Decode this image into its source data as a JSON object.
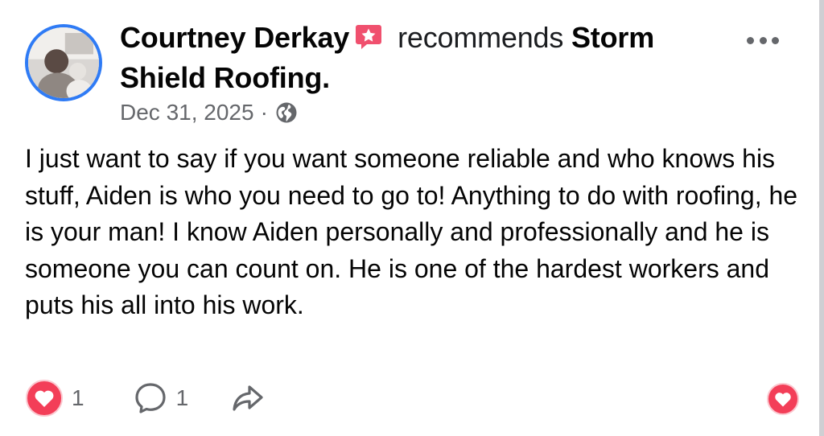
{
  "post": {
    "author": "Courtney Derkay",
    "verb": "recommends",
    "page_name": "Storm Shield Roofing.",
    "date": "Dec 31, 2025",
    "separator": "·",
    "audience_icon": "globe-icon",
    "body": "I just want to say if you want someone reliable and who knows his stuff, Aiden is who you need to go to! Anything to do with roofing, he is your man! I know Aiden personally and professionally and he is someone you can count on. He is one of the hardest workers and puts his all into his work."
  },
  "actions": {
    "like_count": "1",
    "comment_count": "1",
    "share_icon": "share-icon",
    "reaction_icon": "heart-icon"
  },
  "colors": {
    "accent": "#2f7bf5",
    "badge": "#f0506e",
    "reaction": "#f33e58",
    "muted": "#65676b"
  }
}
